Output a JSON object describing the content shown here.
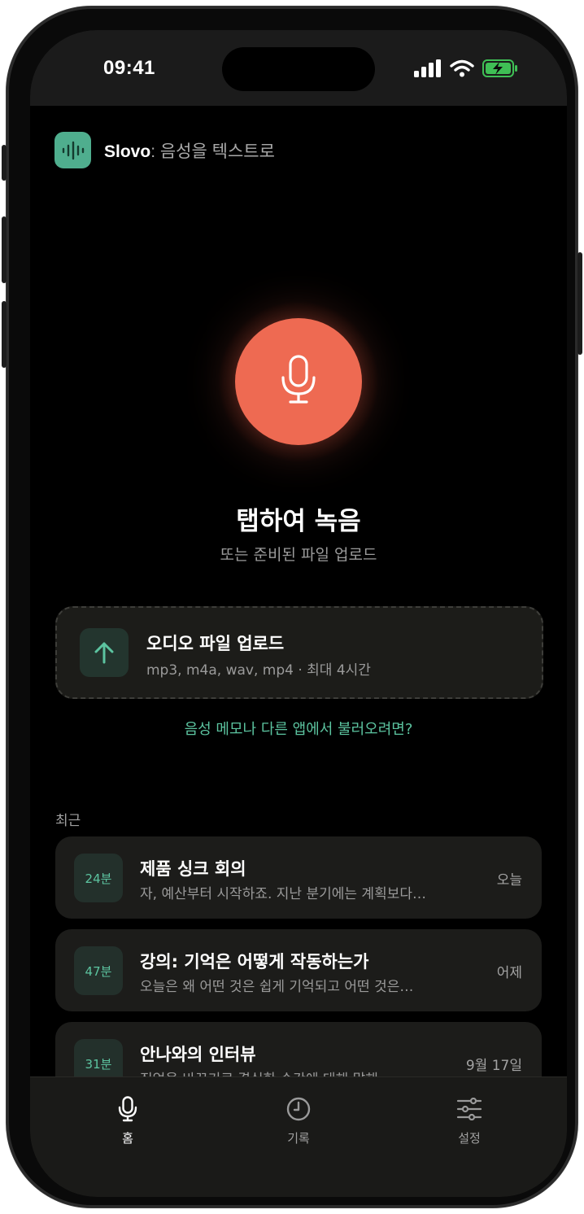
{
  "status_bar": {
    "time": "09:41",
    "icons": [
      "cellular-signal-icon",
      "wifi-icon",
      "battery-charging-icon"
    ]
  },
  "app": {
    "name": "Slovo",
    "tagline": ": 음성을 텍스트로",
    "logo_icon": "waveform-icon",
    "accent_color": "#4fae8e"
  },
  "record": {
    "button_icon": "microphone-icon",
    "button_color": "#ee6a52",
    "title": "탭하여 녹음",
    "subtitle": "또는 준비된 파일 업로드"
  },
  "upload": {
    "icon": "arrow-up-icon",
    "title": "오디오 파일 업로드",
    "formats": "mp3, m4a, wav, mp4 · 최대 4시간"
  },
  "import_link": "음성 메모나 다른 앱에서 불러오려면?",
  "recent": {
    "label": "최근",
    "items": [
      {
        "duration": "24분",
        "title": "제품 싱크 회의",
        "preview": "자, 예산부터 시작하죠. 지난 분기에는 계획보다…",
        "date": "오늘"
      },
      {
        "duration": "47분",
        "title": "강의: 기억은 어떻게 작동하는가",
        "preview": "오늘은 왜 어떤 것은 쉽게 기억되고 어떤 것은…",
        "date": "어제"
      },
      {
        "duration": "31분",
        "title": "안나와의 인터뷰",
        "preview": "직업을 바꾸기로 결심한 순간에 대해 말해…",
        "date": "9월 17일"
      }
    ]
  },
  "tabs": [
    {
      "label": "홈",
      "icon": "microphone-icon",
      "active": true
    },
    {
      "label": "기록",
      "icon": "clock-icon",
      "active": false
    },
    {
      "label": "설정",
      "icon": "sliders-icon",
      "active": false
    }
  ]
}
